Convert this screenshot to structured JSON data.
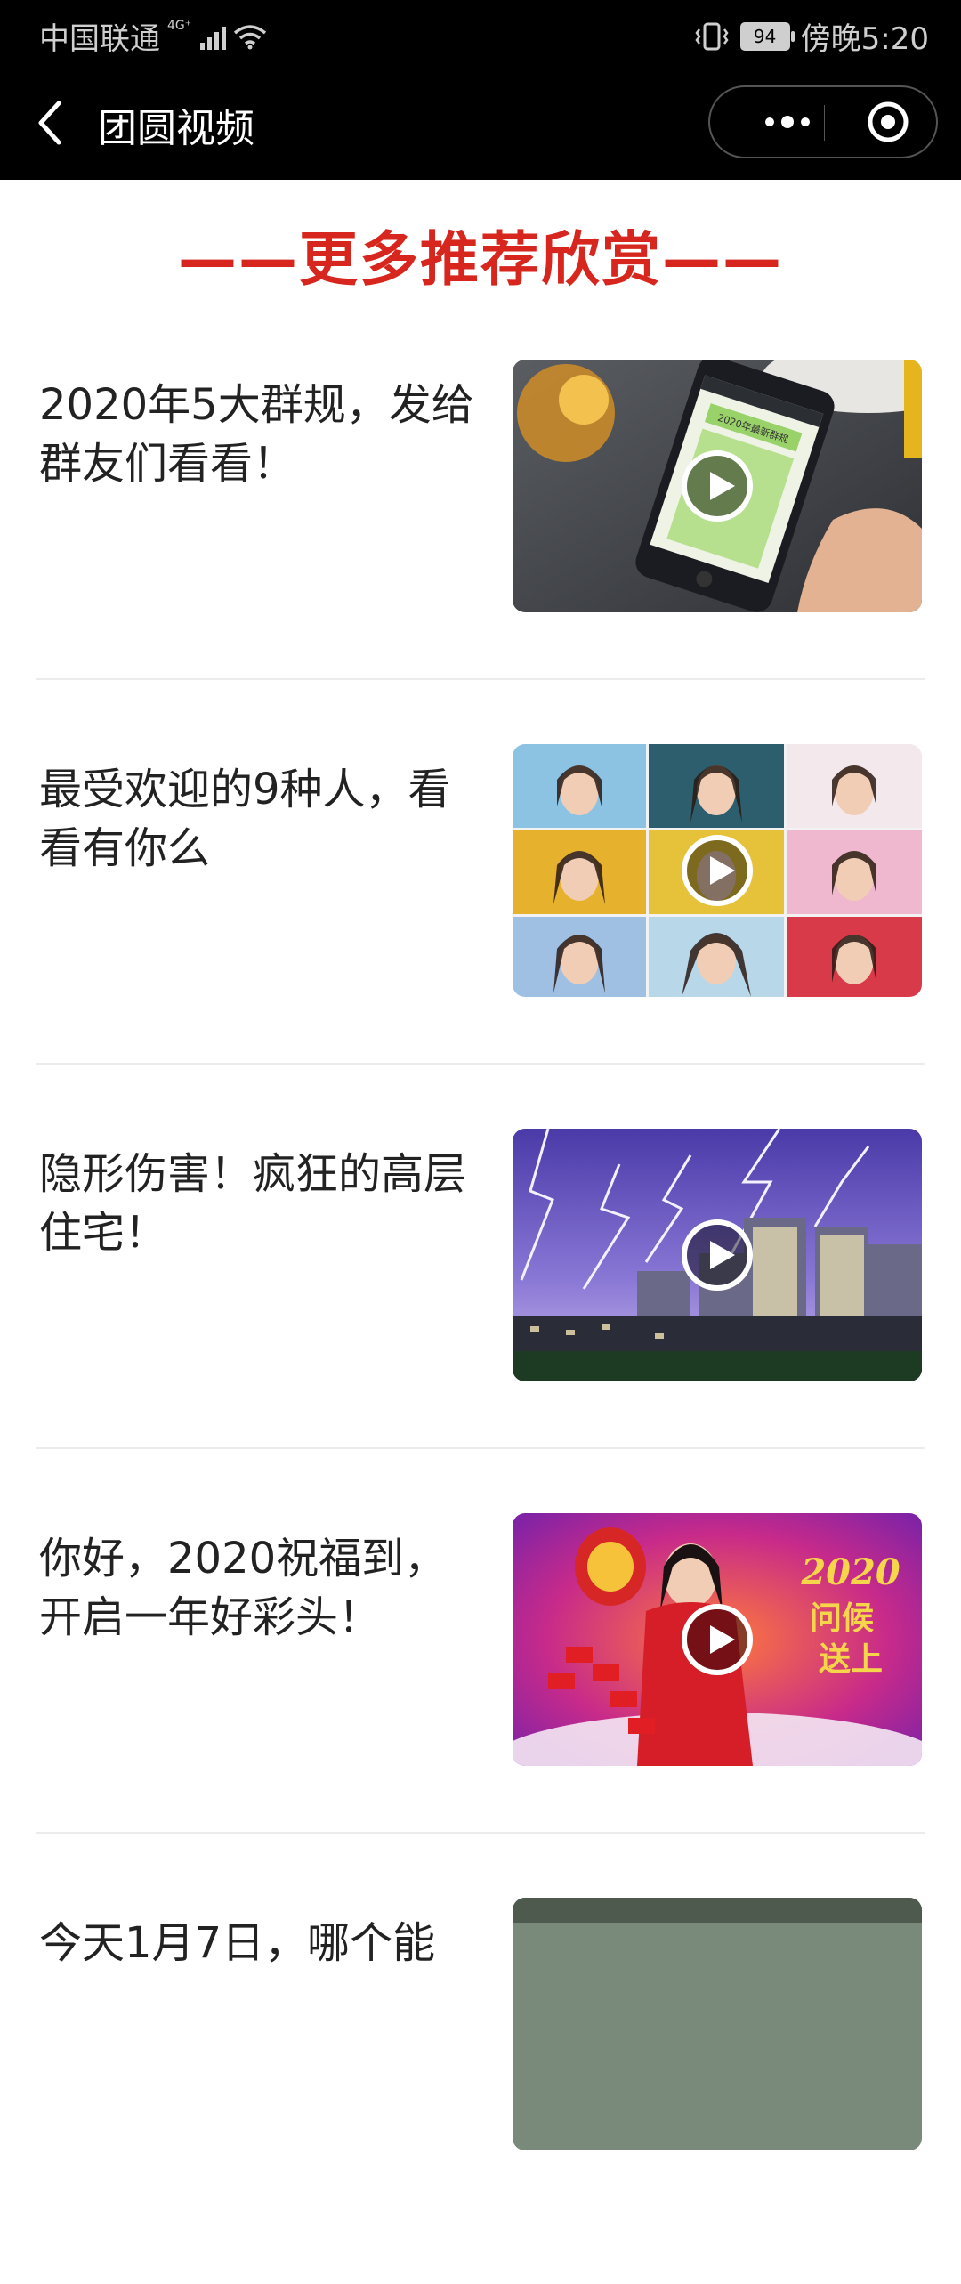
{
  "status_bar": {
    "carrier": "中国联通",
    "network": "4G⁺",
    "battery": "94",
    "time": "傍晚5:20"
  },
  "nav": {
    "title": "团圆视频",
    "more_icon": "more-dots-icon",
    "close_icon": "target-icon"
  },
  "section_title": "——更多推荐欣赏——",
  "items": [
    {
      "title": "2020年5大群规，发给群友们看看！",
      "thumb": "phone-chat"
    },
    {
      "title": "最受欢迎的9种人，看看有你么",
      "thumb": "portrait-grid"
    },
    {
      "title": "隐形伤害！疯狂的高层住宅！",
      "thumb": "lightning-city"
    },
    {
      "title": "你好，2020祝福到，开启一年好彩头！",
      "thumb": "new-year"
    },
    {
      "title": "今天1月7日，哪个能",
      "thumb": "landscape"
    }
  ],
  "thumb_texts": {
    "phone_banner": "2020年最新群规",
    "greeting_year": "2020",
    "greeting_line1": "问候",
    "greeting_line2": "送上"
  },
  "colors": {
    "accent_red": "#d7261e",
    "bar_black": "#000000"
  }
}
